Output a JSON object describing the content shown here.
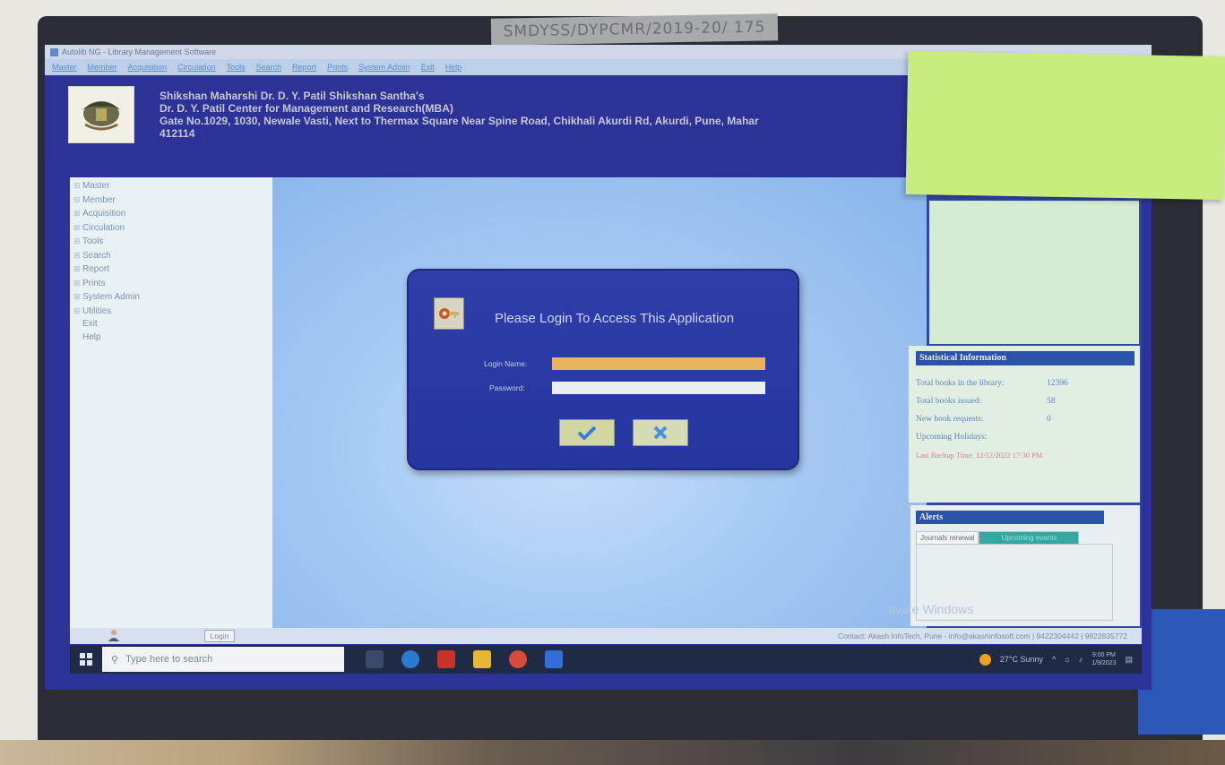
{
  "photo": {
    "doc_stamp": "SMDYSS/DYPCMR/2019-20/ 175"
  },
  "window": {
    "title": "Autolib NG - Library Management Software",
    "menu": [
      "Master",
      "Member",
      "Acquisition",
      "Circulation",
      "Tools",
      "Search",
      "Report",
      "Prints",
      "System Admin",
      "Exit",
      "Help"
    ]
  },
  "header": {
    "line1": "Shikshan Maharshi Dr. D. Y. Patil Shikshan Santha's",
    "line2": "Dr. D. Y. Patil Center for Management and Research(MBA)",
    "line3": "Gate No.1029, 1030, Newale Vasti, Next to Thermax Square Near Spine Road, Chikhali Akurdi Rd, Akurdi, Pune, Mahar",
    "line4": "412114"
  },
  "sidebar": {
    "items": [
      {
        "label": "Master",
        "expandable": true
      },
      {
        "label": "Member",
        "expandable": true
      },
      {
        "label": "Acquisition",
        "expandable": true
      },
      {
        "label": "Circulation",
        "expandable": true
      },
      {
        "label": "Tools",
        "expandable": true
      },
      {
        "label": "Search",
        "expandable": true
      },
      {
        "label": "Report",
        "expandable": true
      },
      {
        "label": "Prints",
        "expandable": true
      },
      {
        "label": "System Admin",
        "expandable": true
      },
      {
        "label": "Utilities",
        "expandable": true
      },
      {
        "label": "Exit",
        "expandable": false
      },
      {
        "label": "Help",
        "expandable": false
      }
    ]
  },
  "login": {
    "title": "Please Login To Access This Application",
    "login_name_label": "Login Name:",
    "password_label": "Password:",
    "login_name_value": "",
    "password_value": ""
  },
  "stats": {
    "header": "Statistical Information",
    "rows": [
      {
        "label": "Total books in the library:",
        "value": "12396"
      },
      {
        "label": "Total books issued:",
        "value": "58"
      },
      {
        "label": "New book requests:",
        "value": "0"
      },
      {
        "label": "Upcoming Holidays:",
        "value": ""
      }
    ],
    "last_backup": "Last Backup Time: 12/12/2022 17:30 PM"
  },
  "alerts": {
    "header": "Alerts",
    "tabs": [
      "Journals renewal",
      "Upcoming events"
    ],
    "watermark": "tivate Windows"
  },
  "status_bar": {
    "login": "Login",
    "contact": "Contact: Akash InfoTech, Pune - info@akashinfosoft.com | 9422304442 | 9822835772"
  },
  "taskbar": {
    "search_placeholder": "Type here to search",
    "weather": "27°C Sunny",
    "time": "9:00 PM",
    "date": "1/9/2023"
  },
  "colors": {
    "screen_blue": "#2c349a",
    "dialog_blue": "#2d3eaa",
    "login_field": "#e9b35d"
  }
}
